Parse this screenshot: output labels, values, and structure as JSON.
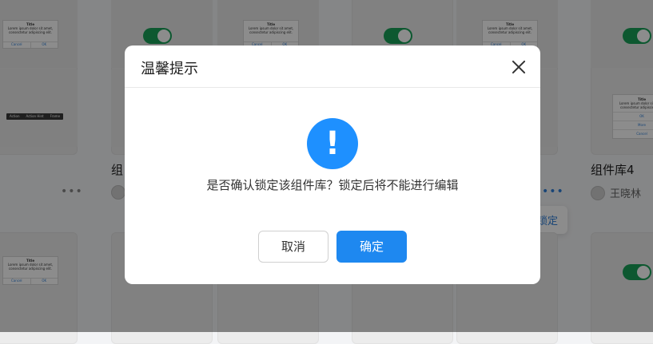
{
  "background": {
    "cards": [
      {
        "title": "组件库4",
        "user": "王晓林"
      }
    ],
    "partial_title": "组",
    "popover_item": "锁定",
    "mini_dialog": {
      "title": "Title",
      "body": "Lorem ipsum dolor sit amet, consectetur adipiscing elit.",
      "cancel": "Cancel",
      "ok": "OK"
    },
    "mini_list": {
      "items": [
        "OK",
        "More",
        "Cancel"
      ]
    },
    "mini_toolbar": {
      "items": [
        "Action",
        "Action Hint",
        "Frame"
      ]
    },
    "more_icon": "•••"
  },
  "modal": {
    "title": "温馨提示",
    "icon": "!",
    "message": "是否确认锁定该组件库？锁定后将不能进行编辑",
    "cancel_label": "取消",
    "ok_label": "确定"
  },
  "colors": {
    "primary": "#1e88f0",
    "warn_icon": "#1e90ff",
    "toggle_on": "#18a058"
  }
}
